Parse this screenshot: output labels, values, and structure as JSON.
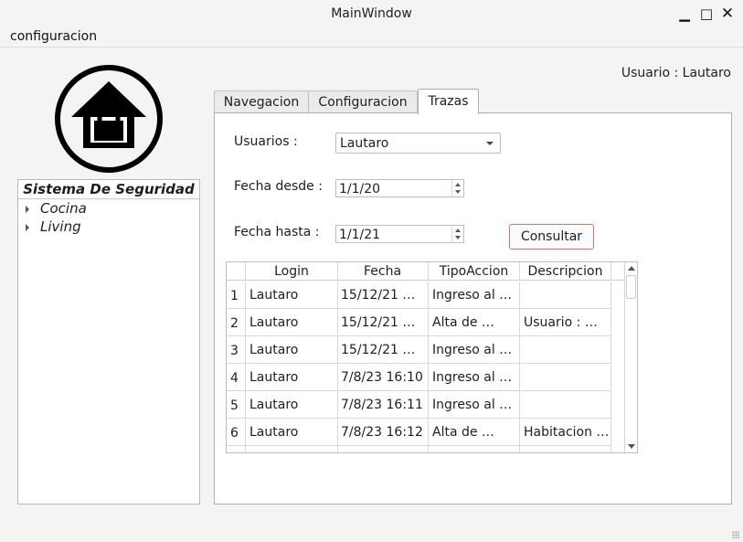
{
  "window": {
    "title": "MainWindow"
  },
  "menu": {
    "configuracion": "configuracion"
  },
  "user_label": "Usuario : Lautaro",
  "tree": {
    "header": "Sistema De Seguridad",
    "items": [
      {
        "label": "Cocina"
      },
      {
        "label": "Living"
      }
    ]
  },
  "tabs": [
    {
      "label": "Navegacion"
    },
    {
      "label": "Configuracion"
    },
    {
      "label": "Trazas",
      "active": true
    }
  ],
  "form": {
    "usuarios_label": "Usuarios :",
    "usuarios_value": "Lautaro",
    "fecha_desde_label": "Fecha desde :",
    "fecha_desde_value": "1/1/20",
    "fecha_hasta_label": "Fecha hasta :",
    "fecha_hasta_value": "1/1/21",
    "consultar_label": "Consultar"
  },
  "table": {
    "columns": [
      "Login",
      "Fecha",
      "TipoAccion",
      "Descripcion"
    ],
    "rows": [
      {
        "num": "1",
        "cells": [
          "Lautaro",
          "15/12/21 …",
          "Ingreso al …",
          ""
        ]
      },
      {
        "num": "2",
        "cells": [
          "Lautaro",
          "15/12/21 …",
          "Alta de …",
          "Usuario : …"
        ]
      },
      {
        "num": "3",
        "cells": [
          "Lautaro",
          "15/12/21 …",
          "Ingreso al …",
          ""
        ]
      },
      {
        "num": "4",
        "cells": [
          "Lautaro",
          "7/8/23 16:10",
          "Ingreso al …",
          ""
        ]
      },
      {
        "num": "5",
        "cells": [
          "Lautaro",
          "7/8/23 16:11",
          "Ingreso al …",
          ""
        ]
      },
      {
        "num": "6",
        "cells": [
          "Lautaro",
          "7/8/23 16:12",
          "Alta de …",
          "Habitacion …"
        ]
      }
    ]
  },
  "colors": {
    "background": "#f5f4f3",
    "panel": "#ffffff",
    "consultar_border": "#e8705a",
    "logo": "#000000"
  },
  "icons": {
    "logo": "house-lock-icon",
    "minimize": "minimize-icon",
    "maximize": "maximize-icon",
    "close": "close-icon"
  }
}
